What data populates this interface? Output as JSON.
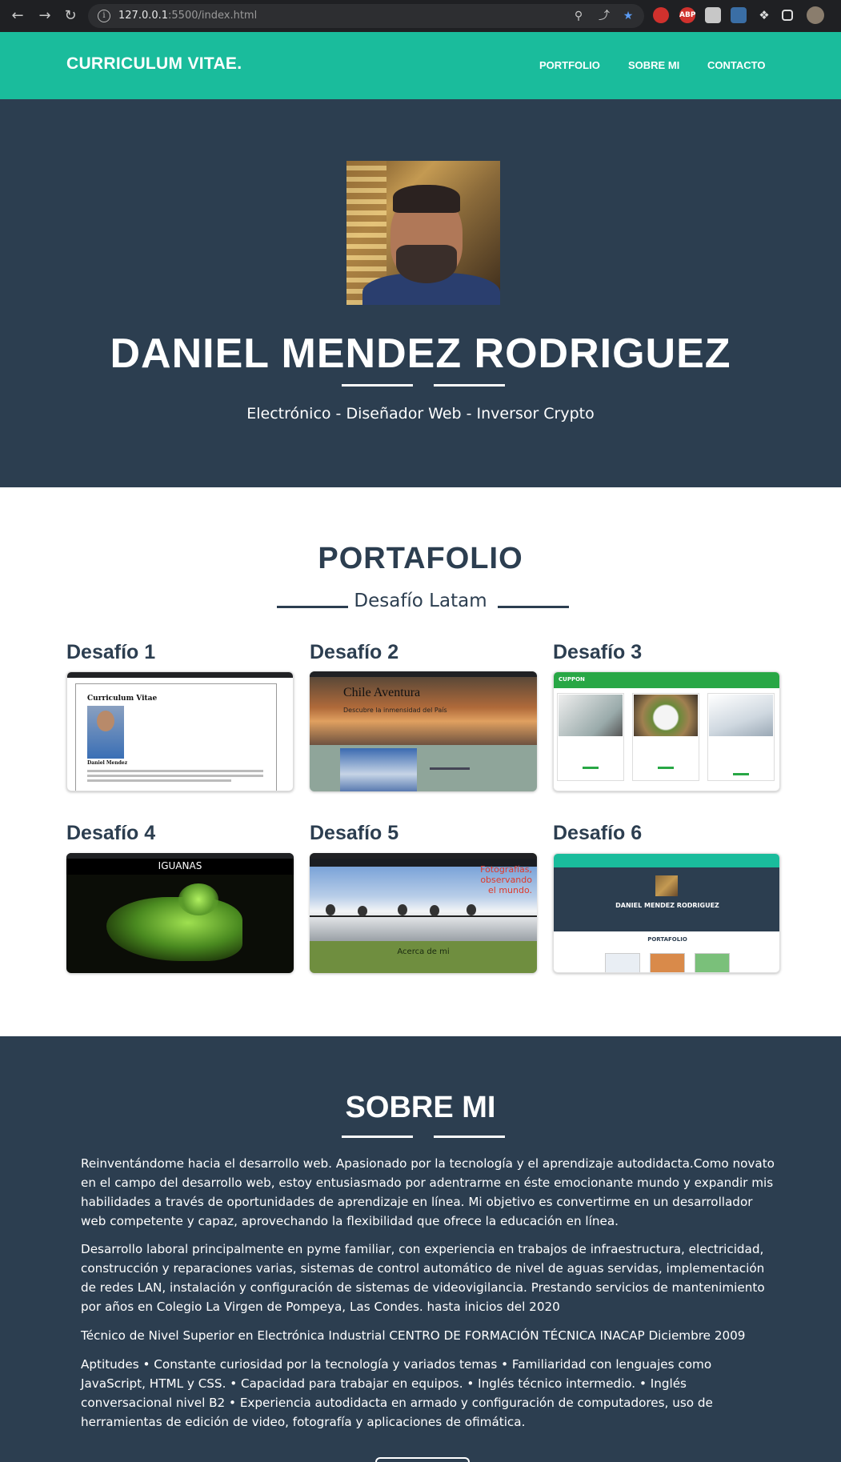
{
  "browser": {
    "url_host": "127.0.0.1",
    "url_path": ":5500/index.html",
    "extensions": [
      "ABP"
    ]
  },
  "nav": {
    "brand": "CURRICULUM VITAE.",
    "links": [
      "PORTFOLIO",
      "SOBRE MI",
      "CONTACTO"
    ]
  },
  "hero": {
    "name": "DANIEL MENDEZ RODRIGUEZ",
    "subtitle": "Electrónico - Diseñador Web - Inversor Crypto"
  },
  "portfolio": {
    "title": "PORTAFOLIO",
    "subtitle": "Desafío Latam",
    "items": [
      {
        "title": "Desafío 1",
        "thumb_text": [
          "Curriculum Vitae",
          "Daniel Mendez"
        ]
      },
      {
        "title": "Desafío 2",
        "thumb_text": [
          "Chile Aventura",
          "Descubre la inmensidad del País"
        ]
      },
      {
        "title": "Desafío 3",
        "thumb_text": [
          "CUPPON"
        ]
      },
      {
        "title": "Desafío 4",
        "thumb_text": [
          "IGUANAS"
        ]
      },
      {
        "title": "Desafío 5",
        "thumb_text": [
          "Fotografías,",
          "observando",
          "el mundo.",
          "Acerca de mi"
        ]
      },
      {
        "title": "Desafío 6",
        "thumb_text": [
          "DANIEL MENDEZ RODRIGUEZ",
          "PORTAFOLIO"
        ]
      }
    ]
  },
  "about": {
    "title": "SOBRE MI",
    "paragraphs": [
      "Reinventándome hacia el desarrollo web. Apasionado por la tecnología y el aprendizaje autodidacta.Como novato en el campo del desarrollo web, estoy entusiasmado por adentrarme en éste emocionante mundo y expandir mis habilidades a través de oportunidades de aprendizaje en línea. Mi objetivo es convertirme en un desarrollador web competente y capaz, aprovechando la flexibilidad que ofrece la educación en línea.",
      "Desarrollo laboral principalmente en pyme familiar, con experiencia en trabajos de infraestructura, electricidad, construcción y reparaciones varias, sistemas de control automático de nivel de aguas servidas, implementación de redes LAN, instalación y configuración de sistemas de videovigilancia. Prestando servicios de mantenimiento por años en Colegio La Virgen de Pompeya, Las Condes. hasta inicios del 2020",
      "Técnico de Nivel Superior en Electrónica Industrial CENTRO DE FORMACIÓN TÉCNICA INACAP Diciembre 2009",
      "Aptitudes • Constante curiosidad por la tecnología y variados temas • Familiaridad con lenguajes como JavaScript, HTML y CSS. • Capacidad para trabajar en equipos. • Inglés técnico intermedio. • Inglés conversacional nivel B2 • Experiencia autodidacta en armado y configuración de computadores, uso de herramientas de edición de video, fotografía y aplicaciones de ofimática."
    ]
  },
  "colors": {
    "nav": "#1abc9c",
    "dark": "#2c3e50"
  }
}
